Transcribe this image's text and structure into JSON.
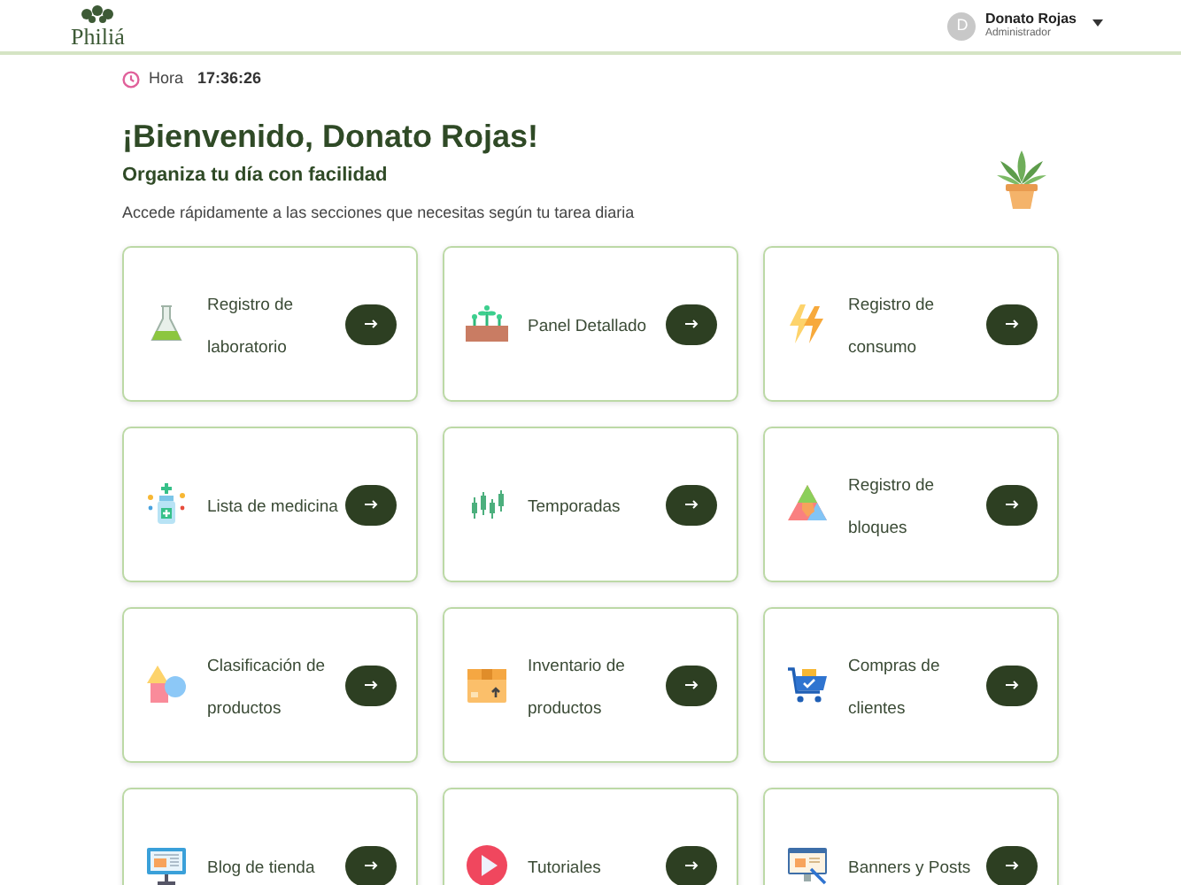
{
  "header": {
    "logo": "Philiá",
    "user": {
      "initial": "D",
      "name": "Donato Rojas",
      "role": "Administrador"
    }
  },
  "clock": {
    "label": "Hora",
    "time": "17:36:26"
  },
  "welcome": {
    "title": "¡Bienvenido, Donato Rojas!",
    "subtitle": "Organiza tu día con facilidad",
    "description": "Accede rápidamente a las secciones que necesitas según tu tarea diaria"
  },
  "cards": [
    {
      "label": "Registro de laboratorio"
    },
    {
      "label": "Panel Detallado"
    },
    {
      "label": "Registro de consumo"
    },
    {
      "label": "Lista de medicina"
    },
    {
      "label": "Temporadas"
    },
    {
      "label": "Registro de bloques"
    },
    {
      "label": "Clasificación de productos"
    },
    {
      "label": "Inventario de productos"
    },
    {
      "label": "Compras de clientes"
    },
    {
      "label": "Blog de tienda"
    },
    {
      "label": "Tutoriales"
    },
    {
      "label": "Banners y Posts"
    }
  ]
}
